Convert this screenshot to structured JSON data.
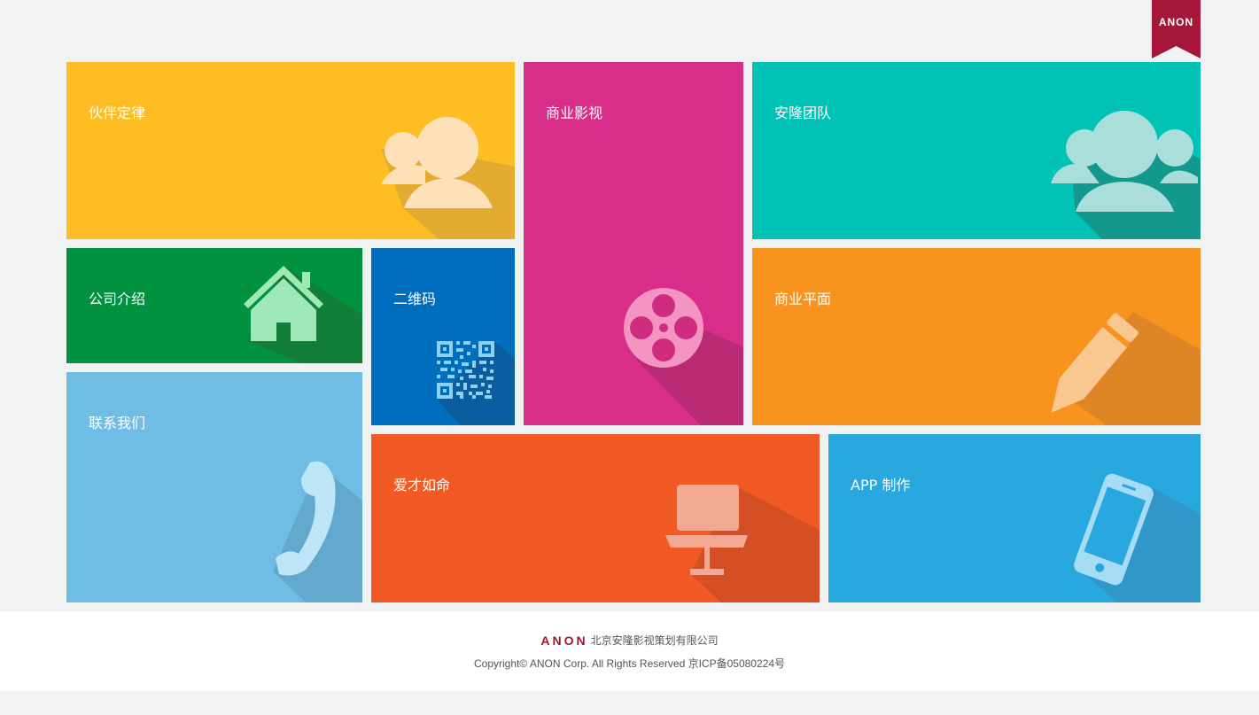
{
  "brand": {
    "ribbon_text": "ANON",
    "ribbon_color": "#a5163a",
    "logo_color": "#a01830"
  },
  "tiles": [
    {
      "key": "partners",
      "label": "伙伴定律",
      "icon": "users-icon",
      "color": "#fdbd23"
    },
    {
      "key": "film",
      "label": "商业影视",
      "icon": "film-reel-icon",
      "color": "#d92d8a"
    },
    {
      "key": "team",
      "label": "安隆团队",
      "icon": "team-icon",
      "color": "#00c3b6"
    },
    {
      "key": "about",
      "label": "公司介绍",
      "icon": "home-icon",
      "color": "#009240"
    },
    {
      "key": "qrcode",
      "label": "二维码",
      "icon": "qr-code-icon",
      "color": "#006ebf"
    },
    {
      "key": "graphic",
      "label": "商业平面",
      "icon": "pencil-icon",
      "color": "#f7931e"
    },
    {
      "key": "contact",
      "label": "联系我们",
      "icon": "phone-icon",
      "color": "#6fbde4"
    },
    {
      "key": "careers",
      "label": "爱才如命",
      "icon": "chair-icon",
      "color": "#f15a24"
    },
    {
      "key": "app",
      "label": "APP 制作",
      "icon": "mobile-icon",
      "color": "#29a8e0"
    }
  ],
  "footer": {
    "logo_text": "ANON",
    "company": "北京安隆影视策划有限公司",
    "copyright": "Copyright© ANON Corp. All Rights Reserved 京ICP备05080224号"
  }
}
